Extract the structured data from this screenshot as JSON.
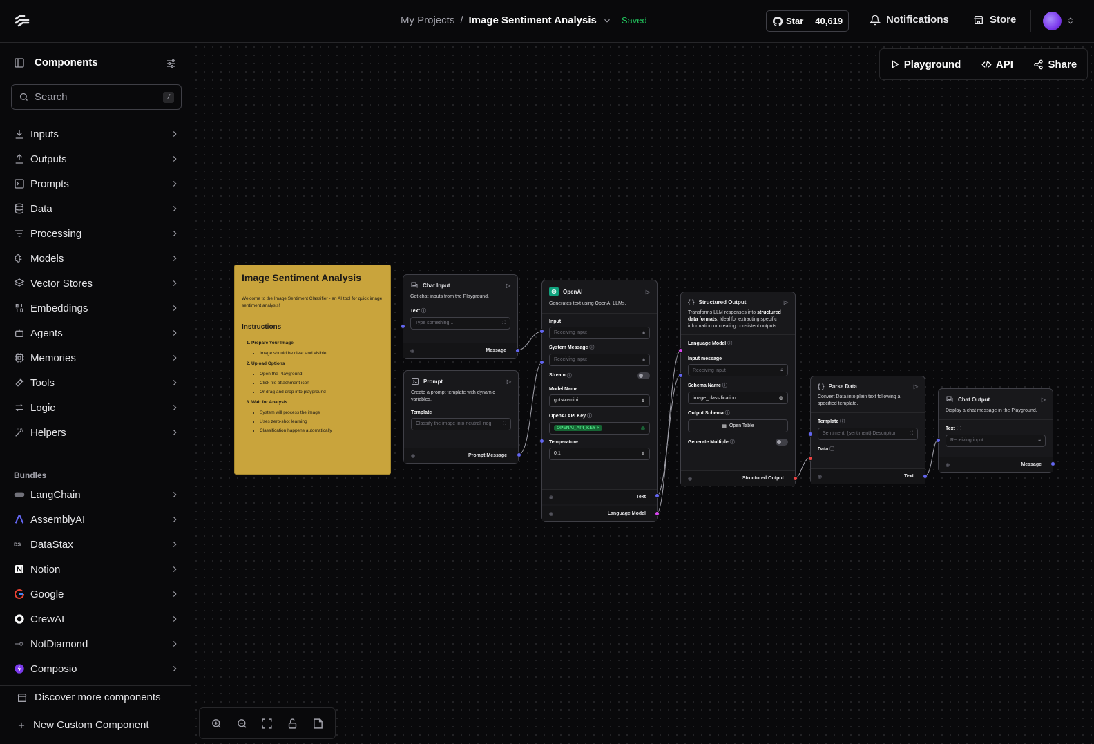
{
  "header": {
    "project": "My Projects",
    "separator": "/",
    "flow_name": "Image Sentiment Analysis",
    "status": "Saved",
    "github_star": "Star",
    "github_count": "40,619",
    "notifications": "Notifications",
    "store": "Store"
  },
  "sidebar": {
    "title": "Components",
    "search_placeholder": "Search",
    "search_shortcut": "/",
    "categories": [
      {
        "label": "Inputs",
        "icon": "download-icon"
      },
      {
        "label": "Outputs",
        "icon": "upload-icon"
      },
      {
        "label": "Prompts",
        "icon": "prompt-icon"
      },
      {
        "label": "Data",
        "icon": "database-icon"
      },
      {
        "label": "Processing",
        "icon": "filter-icon"
      },
      {
        "label": "Models",
        "icon": "brain-icon"
      },
      {
        "label": "Vector Stores",
        "icon": "layers-icon"
      },
      {
        "label": "Embeddings",
        "icon": "binary-icon"
      },
      {
        "label": "Agents",
        "icon": "bot-icon"
      },
      {
        "label": "Memories",
        "icon": "cpu-icon"
      },
      {
        "label": "Tools",
        "icon": "hammer-icon"
      },
      {
        "label": "Logic",
        "icon": "arrows-icon"
      },
      {
        "label": "Helpers",
        "icon": "wand-icon"
      }
    ],
    "bundles_title": "Bundles",
    "bundles": [
      {
        "label": "LangChain"
      },
      {
        "label": "AssemblyAI"
      },
      {
        "label": "DataStax"
      },
      {
        "label": "Notion"
      },
      {
        "label": "Google"
      },
      {
        "label": "CrewAI"
      },
      {
        "label": "NotDiamond"
      },
      {
        "label": "Composio"
      }
    ],
    "discover": "Discover more components",
    "new_custom": "New Custom Component"
  },
  "canvas_actions": {
    "playground": "Playground",
    "api": "API",
    "share": "Share"
  },
  "note": {
    "title": "Image Sentiment Analysis",
    "intro": "Welcome to the Image Sentiment Classifier - an AI tool for quick image sentiment analysis!",
    "instructions_title": "Instructions",
    "steps": [
      {
        "title": "Prepare Your Image",
        "items": [
          "Image should be clear and visible"
        ]
      },
      {
        "title": "Upload Options",
        "items": [
          "Open the Playground",
          "Click file attachment icon",
          "Or drag and drop into playground"
        ]
      },
      {
        "title": "Wait for Analysis",
        "items": [
          "System will process the image",
          "Uses zero-shot learning",
          "Classification happens automatically"
        ]
      }
    ]
  },
  "nodes": {
    "chat_input": {
      "title": "Chat Input",
      "desc": "Get chat inputs from the Playground.",
      "field": "Text",
      "placeholder": "Type something...",
      "output": "Message"
    },
    "prompt": {
      "title": "Prompt",
      "desc": "Create a prompt template with dynamic variables.",
      "field": "Template",
      "value": "Classify the image into neutral, neg",
      "output": "Prompt Message"
    },
    "openai": {
      "title": "OpenAI",
      "desc": "Generates text using OpenAI LLMs.",
      "input_label": "Input",
      "input_ph": "Receiving input",
      "sys_label": "System Message",
      "sys_ph": "Receiving input",
      "stream_label": "Stream",
      "model_label": "Model Name",
      "model_value": "gpt-4o-mini",
      "key_label": "OpenAI API Key",
      "key_value": "OPENAI_API_KEY",
      "temp_label": "Temperature",
      "temp_value": "0.1",
      "out_text": "Text",
      "out_lm": "Language Model"
    },
    "structured": {
      "title": "Structured Output",
      "desc_a": "Transforms LLM responses into ",
      "desc_b": "structured data formats",
      "desc_c": ". Ideal for extracting specific information or creating consistent outputs.",
      "lm_label": "Language Model",
      "input_label": "Input message",
      "input_ph": "Receiving input",
      "schema_label": "Schema Name",
      "schema_value": "image_classification",
      "out_schema_label": "Output Schema",
      "open_table": "Open Table",
      "multiple_label": "Generate Multiple",
      "output": "Structured Output"
    },
    "parse": {
      "title": "Parse Data",
      "desc": "Convert Data into plain text following a specified template.",
      "template_label": "Template",
      "template_value": "Sentiment: {sentiment} Description",
      "data_label": "Data",
      "output": "Text"
    },
    "chat_output": {
      "title": "Chat Output",
      "desc": "Display a chat message in the Playground.",
      "field": "Text",
      "placeholder": "Receiving input",
      "output": "Message"
    }
  },
  "colors": {
    "note_bg": "#c9a43c",
    "handle_message": "#6366f1",
    "handle_model": "#d946ef",
    "handle_data": "#ef4444",
    "saved": "#22c55e"
  }
}
